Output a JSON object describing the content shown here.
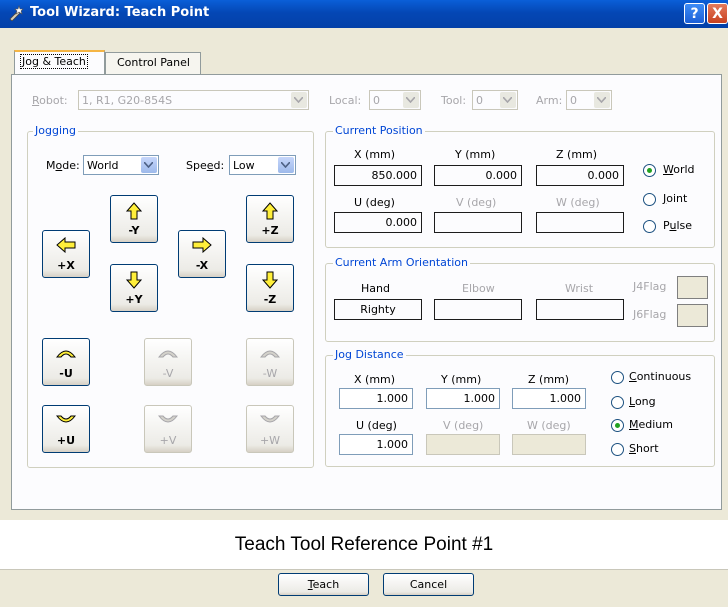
{
  "window": {
    "title": "Tool Wizard: Teach Point",
    "help": "?",
    "close": "X"
  },
  "tabs": [
    "Jog & Teach",
    "Control Panel"
  ],
  "robot": {
    "label": "Robot:",
    "value": "1, R1, G20-854S"
  },
  "local": {
    "label": "Local:",
    "value": "0"
  },
  "tool": {
    "label": "Tool:",
    "value": "0"
  },
  "arm": {
    "label": "Arm:",
    "value": "0"
  },
  "jogging": {
    "title": "Jogging",
    "mode_label": "Mode:",
    "mode_value": "World",
    "speed_label": "Speed:",
    "speed_value": "Low",
    "buttons": {
      "py": "-Y",
      "pz": "+Z",
      "mx": "+X",
      "nx": "-X",
      "ny": "+Y",
      "nz": "-Z",
      "mu": "-U",
      "mv": "-V",
      "mw": "-W",
      "pu": "+U",
      "pv": "+V",
      "pw": "+W"
    }
  },
  "current_position": {
    "title": "Current Position",
    "x_label": "X (mm)",
    "x": "850.000",
    "y_label": "Y (mm)",
    "y": "0.000",
    "z_label": "Z (mm)",
    "z": "0.000",
    "u_label": "U (deg)",
    "u": "0.000",
    "v_label": "V (deg)",
    "v": "",
    "w_label": "W (deg)",
    "w": "",
    "modes": [
      "World",
      "Joint",
      "Pulse"
    ],
    "selected": "World"
  },
  "orientation": {
    "title": "Current Arm Orientation",
    "hand_label": "Hand",
    "hand": "Righty",
    "elbow_label": "Elbow",
    "elbow": "",
    "wrist_label": "Wrist",
    "wrist": "",
    "j4_label": "J4Flag",
    "j6_label": "J6Flag"
  },
  "jog_distance": {
    "title": "Jog Distance",
    "x_label": "X (mm)",
    "x": "1.000",
    "y_label": "Y (mm)",
    "y": "1.000",
    "z_label": "Z (mm)",
    "z": "1.000",
    "u_label": "U (deg)",
    "u": "1.000",
    "v_label": "V (deg)",
    "v": "",
    "w_label": "W (deg)",
    "w": "",
    "options": [
      "Continuous",
      "Long",
      "Medium",
      "Short"
    ],
    "selected": "Medium"
  },
  "banner": "Teach Tool Reference Point #1",
  "buttons": {
    "teach": "Teach",
    "cancel": "Cancel"
  }
}
